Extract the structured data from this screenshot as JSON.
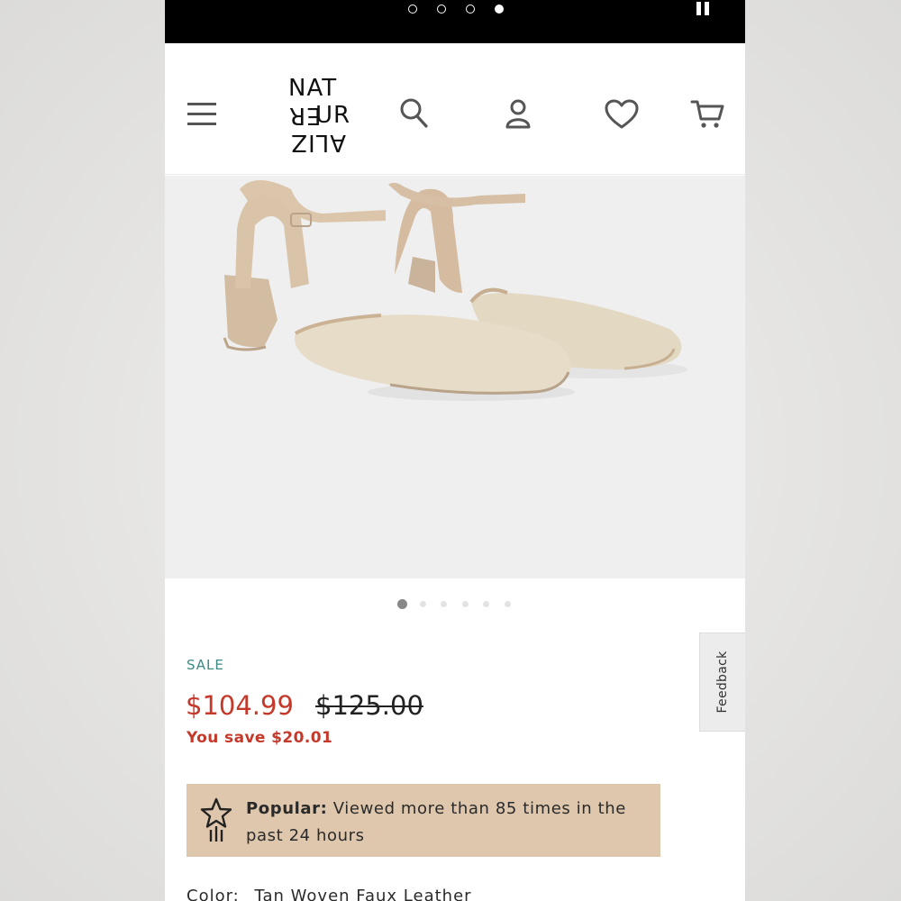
{
  "story": {
    "dot_count": 4,
    "active_dot_index": 3
  },
  "header": {
    "logo": {
      "row1": "NAT",
      "row2": "UR",
      "row2_flipped": "ER",
      "row3": "ALIZ"
    },
    "icons": [
      "menu-icon",
      "search-icon",
      "account-icon",
      "wishlist-heart-icon",
      "cart-icon"
    ]
  },
  "product": {
    "image_alt": "Tan woven faux leather block-heel slingback shoes",
    "carousel": {
      "count": 6,
      "active_index": 0
    },
    "sale_label": "SALE",
    "price_current": "$104.99",
    "price_original": "$125.00",
    "you_save": "You save $20.01",
    "popular": {
      "label": "Popular:",
      "text": " Viewed more than 85 times in the past 24 hours"
    },
    "color_label": "Color:",
    "color_value": "Tan Woven Faux Leather"
  },
  "feedback": {
    "label": "Feedback"
  },
  "colors": {
    "sale_teal": "#3d8a84",
    "price_red": "#c5392b",
    "banner_tan": "#dfc7ad",
    "image_bg": "#efefef"
  }
}
